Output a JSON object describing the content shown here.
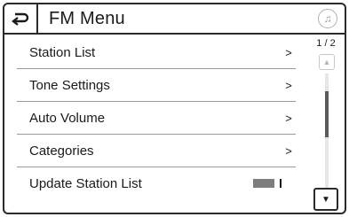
{
  "header": {
    "title": "FM Menu",
    "back_icon": "back-arrow-icon",
    "media_icon": "music-note-icon"
  },
  "menu": {
    "items": [
      {
        "label": "Station List",
        "chevron": ">"
      },
      {
        "label": "Tone Settings",
        "chevron": ">"
      },
      {
        "label": "Auto Volume",
        "chevron": ">"
      },
      {
        "label": "Categories",
        "chevron": ">"
      },
      {
        "label": "Update Station List"
      }
    ]
  },
  "scroll": {
    "page_indicator": "1 / 2",
    "up_glyph": "▲",
    "down_glyph": "▼"
  },
  "media_glyph": "♫"
}
